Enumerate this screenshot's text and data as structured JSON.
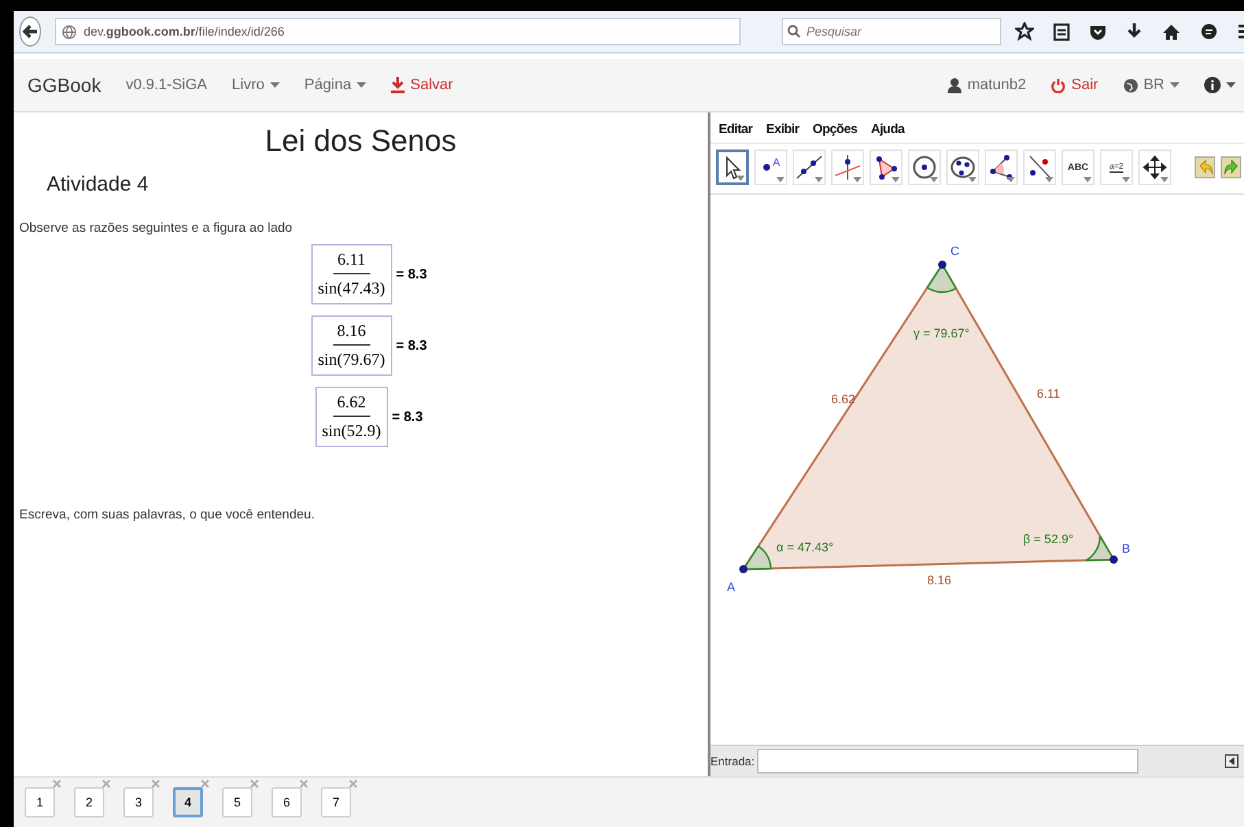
{
  "browser": {
    "url": "dev.**ggbook.com.br**/file/index/id/266",
    "search_placeholder": "Pesquisar"
  },
  "nav": {
    "brand": "GGBook",
    "version": "v0.9.1-SiGA",
    "menus": [
      "Livro",
      "Página"
    ],
    "save": "Salvar",
    "user": "matunb2",
    "logout": "Sair",
    "language": "BR"
  },
  "page": {
    "title": "Lei dos Senos",
    "subtitle": "Atividade 4",
    "instruction": "Observe as razões seguintes e a figura ao lado",
    "ratios": [
      {
        "numerator": "6.11",
        "denominator": "sin(47.43)",
        "result": "= 8.3"
      },
      {
        "numerator": "8.16",
        "denominator": "sin(79.67)",
        "result": "= 8.3"
      },
      {
        "numerator": "6.62",
        "denominator": "sin(52.9)",
        "result": "= 8.3"
      }
    ],
    "prompt": "Escreva, com suas palavras, o que você entendeu."
  },
  "geogebra": {
    "menus": [
      "Editar",
      "Exibir",
      "Opções",
      "Ajuda"
    ],
    "tools": [
      {
        "kind": "move",
        "selected": true
      },
      {
        "kind": "point",
        "label": "A",
        "selected": false
      },
      {
        "kind": "line",
        "selected": false
      },
      {
        "kind": "perpendicular",
        "selected": false
      },
      {
        "kind": "polygon",
        "selected": false
      },
      {
        "kind": "circle",
        "selected": false
      },
      {
        "kind": "conic",
        "selected": false
      },
      {
        "kind": "angle",
        "selected": false
      },
      {
        "kind": "reflect",
        "selected": false
      },
      {
        "kind": "text",
        "label": "ABC",
        "selected": false
      },
      {
        "kind": "slider",
        "label": "a=2",
        "selected": false
      },
      {
        "kind": "pan",
        "selected": false
      }
    ],
    "points": [
      {
        "name": "A"
      },
      {
        "name": "B"
      },
      {
        "name": "C"
      }
    ],
    "sides": [
      {
        "label": "6.62"
      },
      {
        "label": "6.11"
      },
      {
        "label": "8.16"
      }
    ],
    "angles": [
      {
        "label": "α = 47.43°"
      },
      {
        "label": "β = 52.9°"
      },
      {
        "label": "γ = 79.67°"
      }
    ],
    "input_label": "Entrada:"
  },
  "pages": [
    {
      "label": "1",
      "selected": false
    },
    {
      "label": "2",
      "selected": false
    },
    {
      "label": "3",
      "selected": false
    },
    {
      "label": "4",
      "selected": true
    },
    {
      "label": "5",
      "selected": false
    },
    {
      "label": "6",
      "selected": false
    },
    {
      "label": "7",
      "selected": false
    }
  ]
}
